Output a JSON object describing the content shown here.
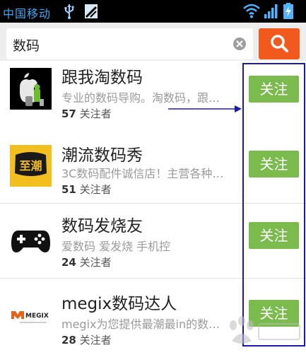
{
  "status_bar": {
    "carrier": "中国移动",
    "icons": [
      "usb-icon",
      "sd-card-icon",
      "wifi-icon",
      "signal-icon",
      "battery-charging-icon"
    ]
  },
  "search": {
    "query": "数码",
    "clear_icon": "clear-icon",
    "button_icon": "search-icon",
    "button_color": "#f15a1c"
  },
  "accounts": [
    {
      "name": "跟我淘数码",
      "desc": "专业的数码导购。淘数码，跟…",
      "count": "57",
      "count_suffix": "关注者",
      "follow": "关注",
      "avatar": "apple-gadgets-avatar"
    },
    {
      "name": "潮流数码秀",
      "desc": "3C数码配件诚信店！主营各种…",
      "count": "51",
      "count_suffix": "关注者",
      "follow": "关注",
      "avatar": "zhichao-logo-avatar"
    },
    {
      "name": "数码发烧友",
      "desc": "爱数码 爱发烧 手机控",
      "count": "24",
      "count_suffix": "关注者",
      "follow": "关注",
      "avatar": "gamepad-avatar"
    },
    {
      "name": "megix数码达人",
      "desc": "megix为您提供最潮最in的数…",
      "count": "28",
      "count_suffix": "关注者",
      "follow": "关注",
      "avatar": "megix-logo-avatar"
    }
  ],
  "avatar_text": {
    "zhichao": "至潮",
    "megix": "MEGIX"
  },
  "colors": {
    "follow_green": "#7bbb4e",
    "annotation_blue": "#1b1ba8",
    "carrier_blue": "#3aa8f5"
  }
}
